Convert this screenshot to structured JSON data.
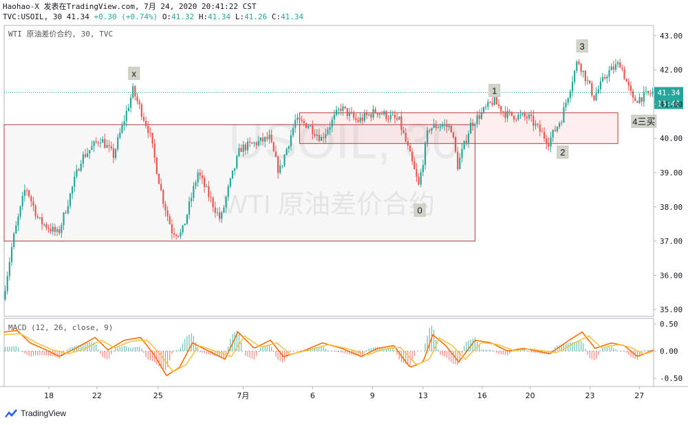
{
  "header": {
    "line1": "Haohao-X 发表在TradingView.com, 7月 24, 2020 20:41:22 CST",
    "symbol": "TVC:USOIL, 30",
    "last": "41.34",
    "change": "+0.30 (+0.74%)",
    "o_label": "O:",
    "o": "41.32",
    "h_label": "H:",
    "h": "41.34",
    "l_label": "L:",
    "l": "41.26",
    "c_label": "C:",
    "c": "41.34"
  },
  "footer": {
    "brand": "TradingView"
  },
  "colors": {
    "up": "#26a69a",
    "down": "#ef5350",
    "macd": "#ff6d00",
    "signal": "#f6c343",
    "box_stroke": "#b13a3a",
    "price_tag": "#26a69a",
    "time_tag": "#26a69a"
  },
  "chart_data": [
    {
      "type": "candlestick",
      "title": "WTI 原油差价合约, 30, TVC",
      "watermark": [
        "USOIL, 30",
        "WTI 原油差价合约"
      ],
      "ylim": [
        34.8,
        43.3
      ],
      "y_ticks": [
        "43.00",
        "42.00",
        "41.00",
        "40.00",
        "39.00",
        "38.00",
        "37.00",
        "36.00",
        "35.00"
      ],
      "x_ticks": [
        "18",
        "22",
        "25",
        "7月",
        "6",
        "9",
        "13",
        "16",
        "20",
        "23",
        "27"
      ],
      "last_price": "41.34",
      "time_tag": "18:40",
      "path_keypoints": [
        [
          0,
          35.3
        ],
        [
          0.015,
          37.0
        ],
        [
          0.035,
          38.6
        ],
        [
          0.055,
          37.6
        ],
        [
          0.085,
          37.2
        ],
        [
          0.12,
          39.4
        ],
        [
          0.15,
          40.0
        ],
        [
          0.17,
          39.5
        ],
        [
          0.2,
          41.4
        ],
        [
          0.225,
          40.2
        ],
        [
          0.245,
          38.3
        ],
        [
          0.26,
          37.3
        ],
        [
          0.275,
          37.2
        ],
        [
          0.3,
          39.0
        ],
        [
          0.335,
          37.6
        ],
        [
          0.345,
          38.4
        ],
        [
          0.365,
          39.7
        ],
        [
          0.41,
          40.0
        ],
        [
          0.425,
          39.0
        ],
        [
          0.45,
          40.5
        ],
        [
          0.47,
          40.4
        ],
        [
          0.49,
          40.0
        ],
        [
          0.52,
          40.9
        ],
        [
          0.545,
          40.5
        ],
        [
          0.575,
          40.8
        ],
        [
          0.61,
          40.5
        ],
        [
          0.625,
          39.6
        ],
        [
          0.64,
          38.6
        ],
        [
          0.655,
          40.3
        ],
        [
          0.675,
          40.4
        ],
        [
          0.69,
          40.3
        ],
        [
          0.7,
          39.2
        ],
        [
          0.72,
          40.4
        ],
        [
          0.755,
          41.1
        ],
        [
          0.775,
          40.7
        ],
        [
          0.81,
          40.6
        ],
        [
          0.84,
          39.9
        ],
        [
          0.86,
          40.6
        ],
        [
          0.885,
          42.3
        ],
        [
          0.91,
          41.2
        ],
        [
          0.93,
          41.9
        ],
        [
          0.95,
          42.2
        ],
        [
          0.97,
          41.1
        ],
        [
          1.0,
          41.34
        ]
      ],
      "labels": [
        {
          "text": "x",
          "at": [
            0.2,
            41.9
          ]
        },
        {
          "text": "0",
          "at": [
            0.64,
            37.9
          ]
        },
        {
          "text": "1",
          "at": [
            0.755,
            41.4
          ]
        },
        {
          "text": "2",
          "at": [
            0.86,
            39.6
          ]
        },
        {
          "text": "3",
          "at": [
            0.89,
            42.7
          ]
        },
        {
          "text": "4三买",
          "at": [
            0.995,
            40.5
          ]
        }
      ],
      "zones": [
        {
          "name": "large-box",
          "y": [
            37.0,
            40.4
          ],
          "x": [
            0,
            0.725
          ]
        },
        {
          "name": "small-box",
          "y": [
            39.85,
            40.75
          ],
          "x": [
            0.455,
            0.945
          ]
        }
      ]
    },
    {
      "type": "line",
      "title": "MACD (12, 26, close, 9)",
      "ylim": [
        -0.65,
        0.6
      ],
      "y_ticks": [
        "0.50",
        "0.00",
        "-0.50"
      ],
      "series": [
        {
          "keypoints": [
            [
              0,
              0.35
            ],
            [
              0.02,
              0.38
            ],
            [
              0.04,
              0.15
            ],
            [
              0.065,
              0.02
            ],
            [
              0.085,
              -0.1
            ],
            [
              0.11,
              0.05
            ],
            [
              0.14,
              0.25
            ],
            [
              0.16,
              0.02
            ],
            [
              0.185,
              0.2
            ],
            [
              0.21,
              0.25
            ],
            [
              0.23,
              -0.05
            ],
            [
              0.25,
              -0.45
            ],
            [
              0.27,
              -0.3
            ],
            [
              0.29,
              0.15
            ],
            [
              0.315,
              0.0
            ],
            [
              0.34,
              -0.15
            ],
            [
              0.36,
              0.35
            ],
            [
              0.385,
              0.05
            ],
            [
              0.41,
              0.2
            ],
            [
              0.43,
              -0.1
            ],
            [
              0.46,
              0.0
            ],
            [
              0.49,
              0.15
            ],
            [
              0.52,
              0.05
            ],
            [
              0.55,
              -0.1
            ],
            [
              0.575,
              0.05
            ],
            [
              0.6,
              0.1
            ],
            [
              0.625,
              -0.3
            ],
            [
              0.645,
              -0.2
            ],
            [
              0.66,
              0.3
            ],
            [
              0.68,
              0.1
            ],
            [
              0.7,
              -0.2
            ],
            [
              0.725,
              0.2
            ],
            [
              0.75,
              0.15
            ],
            [
              0.775,
              0.0
            ],
            [
              0.8,
              0.05
            ],
            [
              0.84,
              -0.05
            ],
            [
              0.87,
              0.2
            ],
            [
              0.89,
              0.35
            ],
            [
              0.91,
              0.05
            ],
            [
              0.935,
              0.15
            ],
            [
              0.955,
              0.1
            ],
            [
              0.975,
              -0.1
            ],
            [
              1.0,
              0.02
            ]
          ]
        },
        {
          "keypoints": [
            [
              0,
              0.3
            ],
            [
              0.025,
              0.32
            ],
            [
              0.05,
              0.15
            ],
            [
              0.075,
              0.02
            ],
            [
              0.1,
              -0.05
            ],
            [
              0.125,
              0.05
            ],
            [
              0.15,
              0.2
            ],
            [
              0.17,
              0.06
            ],
            [
              0.195,
              0.18
            ],
            [
              0.22,
              0.2
            ],
            [
              0.24,
              -0.05
            ],
            [
              0.26,
              -0.38
            ],
            [
              0.28,
              -0.25
            ],
            [
              0.3,
              0.1
            ],
            [
              0.325,
              0.0
            ],
            [
              0.35,
              -0.1
            ],
            [
              0.37,
              0.28
            ],
            [
              0.395,
              0.07
            ],
            [
              0.42,
              0.15
            ],
            [
              0.44,
              -0.06
            ],
            [
              0.47,
              0.02
            ],
            [
              0.5,
              0.12
            ],
            [
              0.53,
              0.04
            ],
            [
              0.56,
              -0.07
            ],
            [
              0.585,
              0.04
            ],
            [
              0.61,
              0.07
            ],
            [
              0.635,
              -0.25
            ],
            [
              0.655,
              -0.15
            ],
            [
              0.67,
              0.24
            ],
            [
              0.69,
              0.1
            ],
            [
              0.71,
              -0.15
            ],
            [
              0.735,
              0.16
            ],
            [
              0.76,
              0.12
            ],
            [
              0.785,
              0.01
            ],
            [
              0.81,
              0.04
            ],
            [
              0.85,
              -0.03
            ],
            [
              0.88,
              0.16
            ],
            [
              0.9,
              0.28
            ],
            [
              0.92,
              0.06
            ],
            [
              0.945,
              0.12
            ],
            [
              0.965,
              0.07
            ],
            [
              0.985,
              -0.06
            ],
            [
              1.0,
              0.0
            ]
          ]
        }
      ]
    }
  ]
}
